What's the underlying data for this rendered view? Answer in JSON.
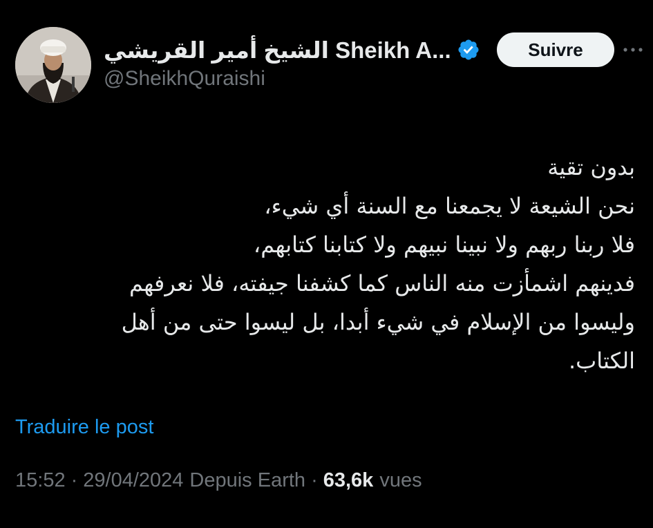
{
  "author": {
    "display_name": "الشيخ أمير القريشي Sheikh A...",
    "handle": "@SheikhQuraishi",
    "verified": true,
    "avatar_icon": "cleric-portrait-avatar"
  },
  "actions": {
    "follow_label": "Suivre",
    "more_icon": "more-options-icon"
  },
  "tweet": {
    "lines": [
      "بدون تقية",
      "نحن الشيعة لا يجمعنا مع السنة أي شيء،",
      "فلا ربنا ربهم ولا نبينا نبيهم ولا كتابنا كتابهم،",
      "فدينهم اشمأزت منه الناس كما كشفنا جيفته، فلا نعرفهم",
      "وليسوا من الإسلام في شيء أبدا، بل ليسوا حتى من أهل",
      "الكتاب."
    ]
  },
  "translate_label": "Traduire le post",
  "meta": {
    "time": "15:52",
    "separator": "·",
    "date": "29/04/2024",
    "source": "Depuis Earth",
    "views_count": "63,6k",
    "views_label": "vues"
  },
  "colors": {
    "background": "#000000",
    "text_primary": "#e7e9ea",
    "text_secondary": "#71767b",
    "link": "#1d9bf0",
    "verified_badge": "#1d9bf0",
    "follow_button_bg": "#eff3f4"
  }
}
